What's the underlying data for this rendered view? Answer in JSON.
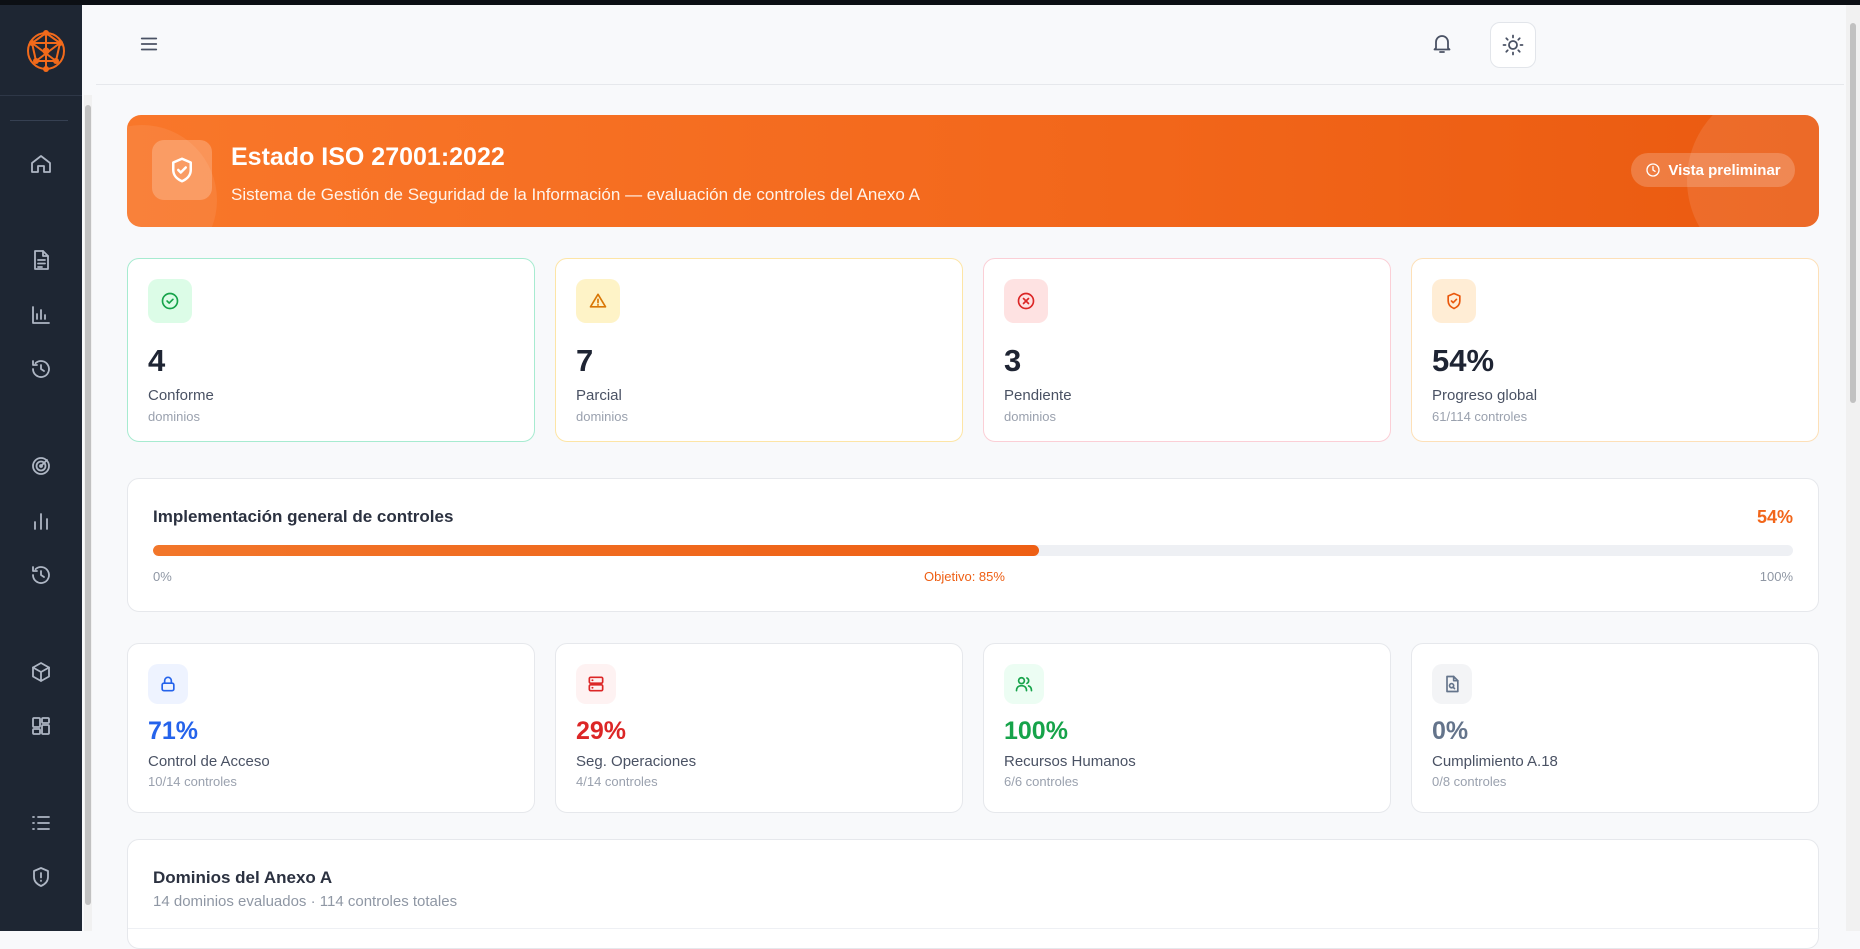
{
  "colors": {
    "accent": "#f2661a",
    "sidebar": "#1e2633",
    "success": "#16a34a",
    "warning": "#d97706",
    "danger": "#dc2626",
    "info": "#2563eb",
    "muted": "#64748b"
  },
  "sidebar": {
    "logo": "network-logo",
    "items": [
      {
        "icon": "home-icon"
      },
      {
        "icon": "document-icon"
      },
      {
        "icon": "bar-chart-icon"
      },
      {
        "icon": "history-icon"
      },
      {
        "icon": "radar-icon"
      },
      {
        "icon": "bar-chart-icon"
      },
      {
        "icon": "history-icon"
      },
      {
        "icon": "cube-icon"
      },
      {
        "icon": "dashboard-icon"
      },
      {
        "icon": "list-icon"
      },
      {
        "icon": "shield-alert-icon"
      }
    ]
  },
  "header": {
    "menu_icon": "hamburger-icon",
    "notification_icon": "bell-icon",
    "theme_icon": "sun-icon"
  },
  "banner": {
    "title": "Estado ISO 27001:2022",
    "subtitle": "Sistema de Gestión de Seguridad de la Información — evaluación de controles del Anexo A",
    "icon": "shield-check-icon",
    "button_label": "Vista preliminar",
    "button_icon": "clock-icon"
  },
  "stats": [
    {
      "value": "4",
      "label": "Conforme",
      "sub": "dominios",
      "icon": "check-circle-icon",
      "color": "#16a34a"
    },
    {
      "value": "7",
      "label": "Parcial",
      "sub": "dominios",
      "icon": "warning-icon",
      "color": "#d97706"
    },
    {
      "value": "3",
      "label": "Pendiente",
      "sub": "dominios",
      "icon": "x-circle-icon",
      "color": "#dc2626"
    },
    {
      "value": "54%",
      "label": "Progreso global",
      "sub": "61/114 controles",
      "icon": "shield-check-icon",
      "color": "#ea580c"
    }
  ],
  "implementation": {
    "title": "Implementación general de controles",
    "percent_label": "54%",
    "progress": 0.54,
    "min_label": "0%",
    "target_label": "Objetivo: 85%",
    "max_label": "100%"
  },
  "domains": [
    {
      "value": "71%",
      "label": "Control de Acceso",
      "sub": "10/14 controles",
      "icon": "lock-icon",
      "color": "#2563eb"
    },
    {
      "value": "29%",
      "label": "Seg. Operaciones",
      "sub": "4/14 controles",
      "icon": "server-icon",
      "color": "#dc2626"
    },
    {
      "value": "100%",
      "label": "Recursos Humanos",
      "sub": "6/6 controles",
      "icon": "users-icon",
      "color": "#16a34a"
    },
    {
      "value": "0%",
      "label": "Cumplimiento A.18",
      "sub": "0/8 controles",
      "icon": "file-search-icon",
      "color": "#64748b"
    }
  ],
  "domain_list": {
    "title": "Dominios del Anexo A",
    "subtitle": "14 dominios evaluados · 114 controles totales"
  }
}
